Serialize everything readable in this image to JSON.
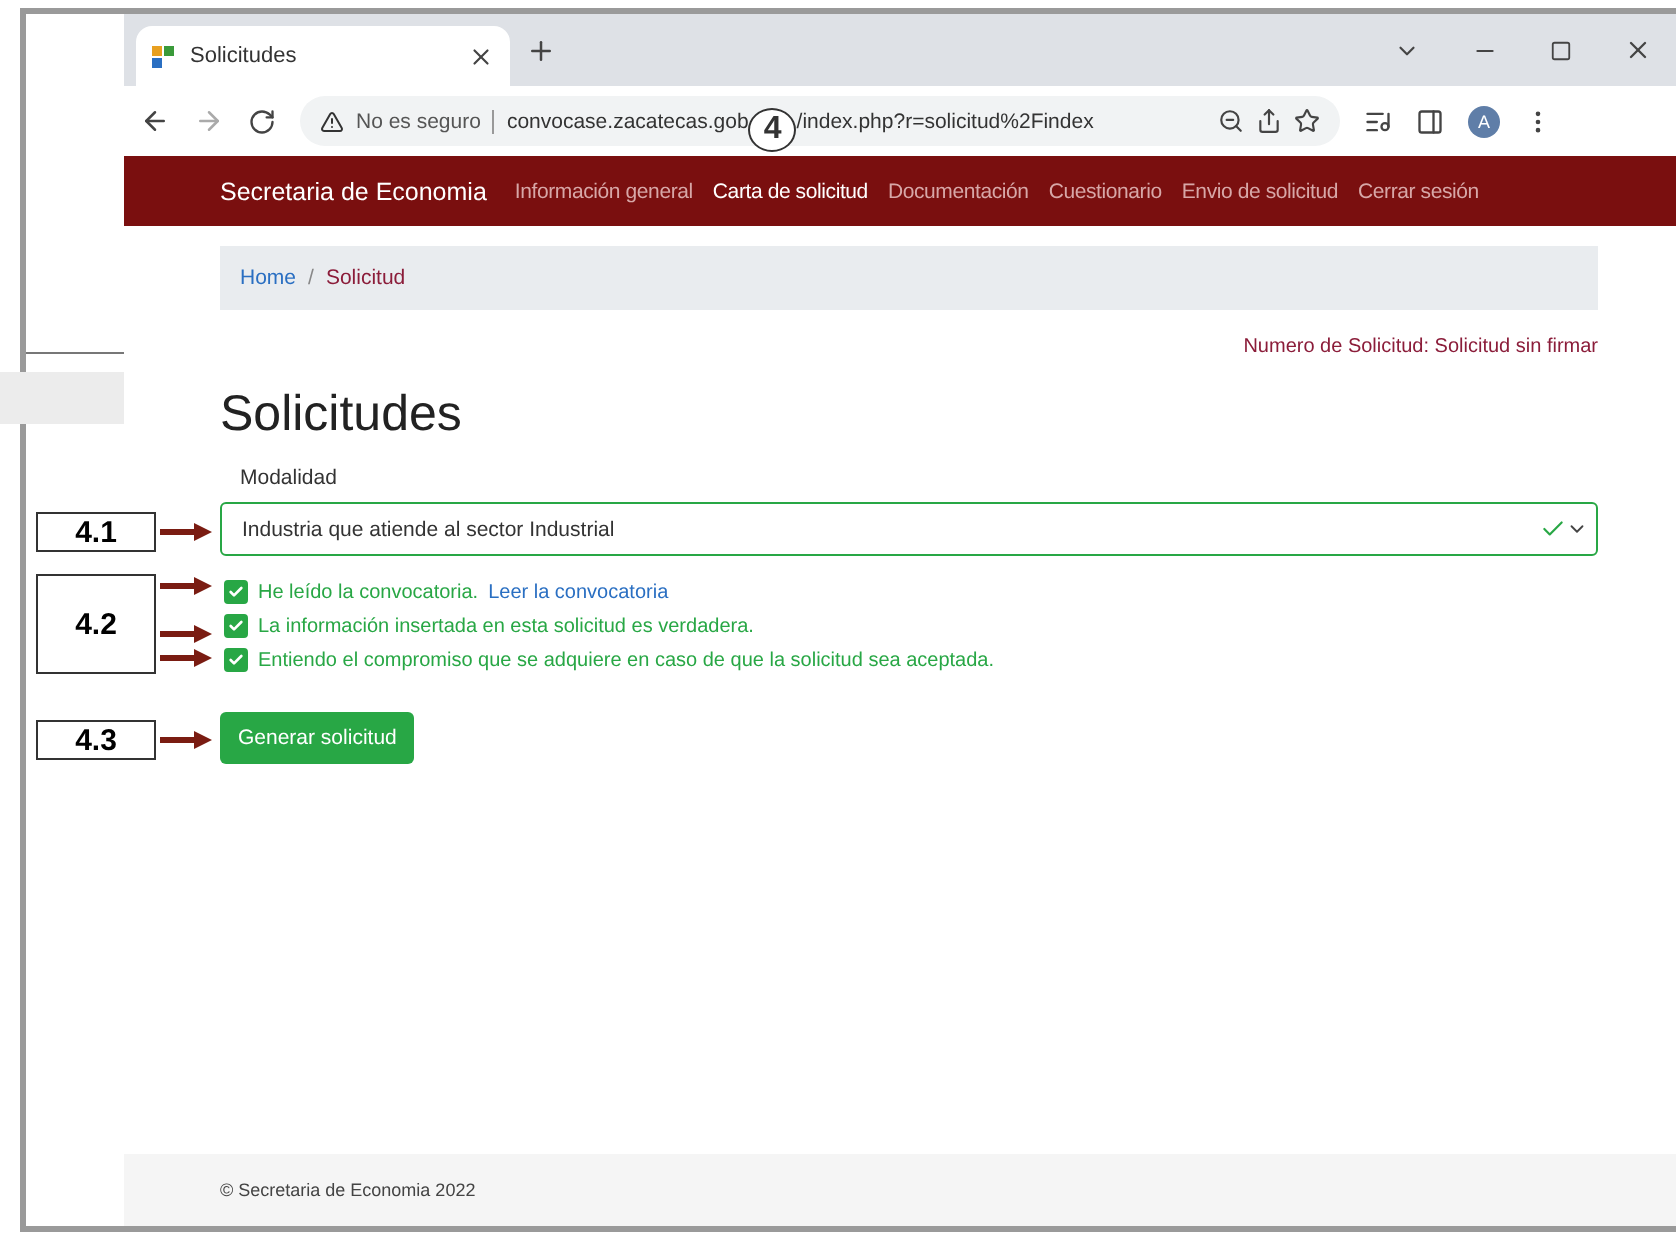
{
  "browser": {
    "tab_title": "Solicitudes",
    "security_label": "No es seguro",
    "url_parts": [
      "convocase.zacatecas.gob",
      "/index.php?r=solicitud%2Findex"
    ],
    "avatar": "A"
  },
  "navbar": {
    "brand": "Secretaria de Economia",
    "items": [
      {
        "label": "Información general",
        "selected": false
      },
      {
        "label": "Carta de solicitud",
        "selected": true
      },
      {
        "label": "Documentación",
        "selected": false
      },
      {
        "label": "Cuestionario",
        "selected": false
      },
      {
        "label": "Envio de solicitud",
        "selected": false
      },
      {
        "label": "Cerrar sesión",
        "selected": false
      }
    ]
  },
  "breadcrumb": [
    {
      "label": "Home",
      "kind": "link"
    },
    {
      "label": "/",
      "kind": "separator"
    },
    {
      "label": "Solicitud",
      "kind": "current"
    }
  ],
  "request_number": "Numero de Solicitud: Solicitud sin firmar",
  "title": "Solicitudes",
  "modalidad": {
    "label": "Modalidad",
    "value": "Industria que atiende al sector Industrial",
    "valid": true
  },
  "checkboxes": [
    {
      "label": "He leído la convocatoria.",
      "link": "Leer la convocatoria",
      "checked": true
    },
    {
      "label": "La información insertada en esta solicitud es verdadera.",
      "checked": true
    },
    {
      "label": "Entiendo el compromiso que se adquiere en caso de que la solicitud sea aceptada.",
      "checked": true
    }
  ],
  "button": "Generar solicitud",
  "footer": "© Secretaria de Economia 2022",
  "annotations": [
    {
      "kind": "circle",
      "label": "4"
    },
    {
      "kind": "box",
      "label": "4.1"
    },
    {
      "kind": "box",
      "label": "4.2"
    },
    {
      "kind": "box",
      "label": "4.3"
    }
  ]
}
